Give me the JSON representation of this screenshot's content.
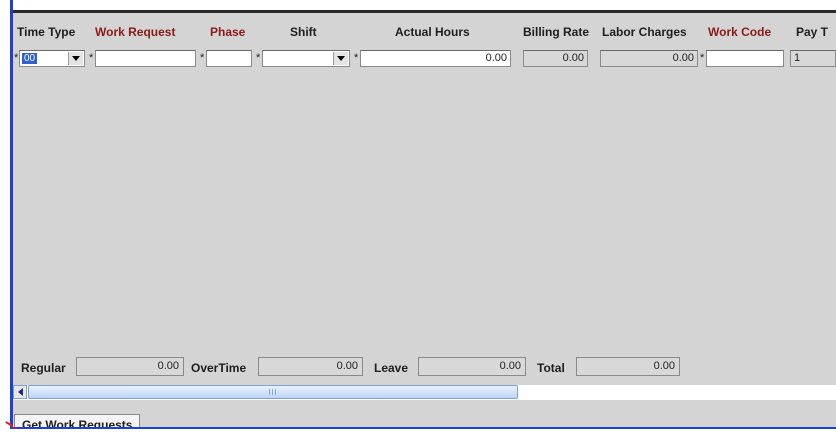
{
  "columns": [
    {
      "key": "time_type",
      "label": "Time Type",
      "color": "dark"
    },
    {
      "key": "work_request",
      "label": "Work Request",
      "color": "red"
    },
    {
      "key": "phase",
      "label": "Phase",
      "color": "red"
    },
    {
      "key": "shift",
      "label": "Shift",
      "color": "dark"
    },
    {
      "key": "actual_hours",
      "label": "Actual Hours",
      "color": "dark"
    },
    {
      "key": "billing_rate",
      "label": "Billing Rate",
      "color": "dark"
    },
    {
      "key": "labor_charges",
      "label": "Labor Charges",
      "color": "dark"
    },
    {
      "key": "work_code",
      "label": "Work Code",
      "color": "red"
    },
    {
      "key": "pay_type",
      "label": "Pay T",
      "color": "dark"
    }
  ],
  "required_marker": "*",
  "row": {
    "time_type": "00",
    "work_request": "",
    "phase": "",
    "shift": "",
    "actual_hours": "0.00",
    "billing_rate": "0.00",
    "labor_charges": "0.00",
    "work_code": "",
    "pay_type": "1"
  },
  "totals": {
    "regular_label": "Regular",
    "regular_value": "0.00",
    "overtime_label": "OverTime",
    "overtime_value": "0.00",
    "leave_label": "Leave",
    "leave_value": "0.00",
    "total_label": "Total",
    "total_value": "0.00"
  },
  "buttons": {
    "get_work_requests": "Get Work Requests"
  },
  "colors": {
    "header_red": "#8b1a1a",
    "panel_bg": "#d4d4d4",
    "frame_blue": "#1f3fd8",
    "selection_blue": "#2f5fd0"
  },
  "icons": [
    "dropdown-arrow-icon",
    "scroll-left-arrow-icon"
  ]
}
